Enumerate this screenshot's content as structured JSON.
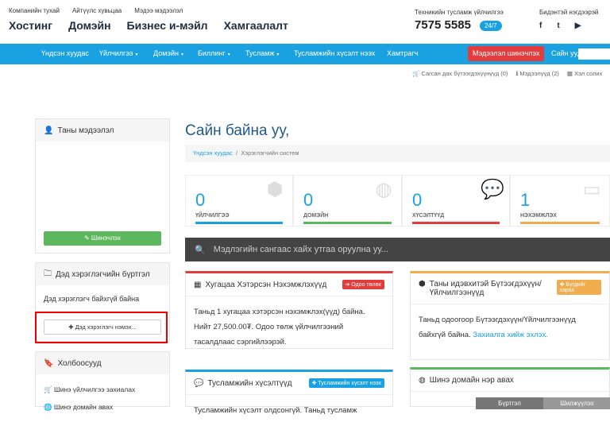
{
  "header": {
    "toplinks": [
      "Компанийн тухай",
      "Айтүүлс хувьцаа",
      "Мэдээ мэдээлэл"
    ],
    "mainlinks": [
      "Хостинг",
      "Домэйн",
      "Бизнес и-мэйл",
      "Хамгаалалт"
    ],
    "support_label": "Техникийн тусламж үйлчилгээ",
    "phone": "7575 5585",
    "badge": "24/7",
    "social_label": "Бидэнтэй нэгдээрэй",
    "social_icons": [
      "f",
      "t",
      "▶"
    ]
  },
  "nav": {
    "items": [
      "Үндсэн хуудас",
      "Үйлчилгээ",
      "Домэйн",
      "Биллинг",
      "Тусламж",
      "Тусламжийн хүсэлт нээх",
      "Хамтрагч"
    ],
    "alert": "Мэдээлэл шинэчлэх",
    "hello": "Сайн уу,"
  },
  "util": {
    "cart": "Сагсан дах бүтээгдэхүүнүүд (0)",
    "notices": "Мэдээлүүд (2)",
    "logout": "Хэл солих"
  },
  "sidebar": {
    "info_title": "Таны мэдээлэл",
    "update_btn": "✎ Шинэчлэх",
    "contacts_title": "Дэд хэрэглэгчийн бүртгэл",
    "contacts_empty": "Дэд хэрэглэгч байхгүй байна",
    "add_contact": "✚ Дэд хэрэглэгч нэмэх...",
    "links_title": "Холбоосууд",
    "links": [
      "Шинэ үйлчилгээ захиалах",
      "Шинэ домайн авах"
    ]
  },
  "main": {
    "title": "Сайн байна уу,",
    "crumb_home": "Үндсэн хуудас",
    "crumb_current": "Хэрэглэгчийн систем",
    "stats": [
      {
        "num": "0",
        "label": "ҮЙЛЧИЛГЭЭ",
        "color": "#1aa1e1"
      },
      {
        "num": "0",
        "label": "ДОМЭЙН",
        "color": "#5cb85c"
      },
      {
        "num": "0",
        "label": "ХҮСЭЛТҮҮД",
        "color": "#e23c3c"
      },
      {
        "num": "1",
        "label": "НЭХЭМЖЛЭХ",
        "color": "#f0ad4e"
      }
    ],
    "search_placeholder": "Мэдлэгийн сангаас хайх утгаа оруулна уу...",
    "invoice_title": "Хугацаа Хэтэрсэн Нэхэмжлэхүүд",
    "invoice_btn": "➔ Одоо төлөх",
    "invoice_text": "Таньд 1 хугацаа хэтэрсэн нэхэмжлэх(үүд) байна. Нийт 27,500.00₮. Одоо төлж үйлчилгээний тасалдлаас сэргийлээрэй.",
    "active_title": "Таны идэвхитэй Бүтээгдэхүүн/ Үйлчилгээнүүд",
    "active_btn": "✚ Бүгдийг харах",
    "active_text": "Таньд одоогоор Бүтээгдэхүүн/Үйлчилгээнүүд байхгүй байна.",
    "active_link": "Захиалга хийж эхлэх.",
    "tickets_title": "Тусламжийн хүсэлтүүд",
    "tickets_btn": "✚ Тусламжийн хүсэлт нээх",
    "tickets_text": "Тусламжийн хүсэлт олдсонгүй. Таньд тусламж",
    "domain_title": "Шинэ домайн нэр авах",
    "domain_tabs": [
      "Бүртгэл",
      "Шилжүүлэх"
    ]
  }
}
